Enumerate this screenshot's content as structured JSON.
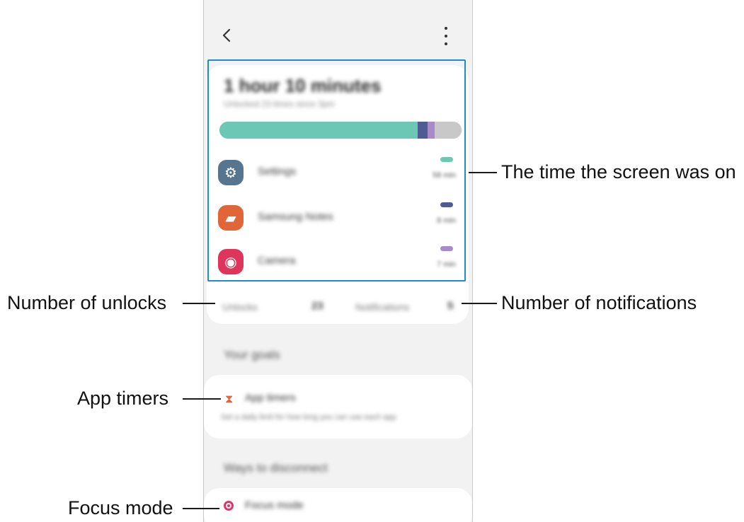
{
  "callouts": {
    "screen_time": "The time the screen was on",
    "unlocks": "Number of unlocks",
    "notifications": "Number of notifications",
    "app_timers": "App timers",
    "focus_mode": "Focus mode"
  },
  "topbar": {
    "back_icon": "chevron-left-icon",
    "more_icon": "more-vertical-icon"
  },
  "summary": {
    "total_time": "1 hour 10 minutes",
    "subtitle": "Unlocked 23 times since 3pm",
    "usage_segments": [
      {
        "app": "Settings",
        "fraction": 0.82,
        "color": "#6cc7b5"
      },
      {
        "app": "Samsung Notes",
        "fraction": 0.04,
        "color": "#4f5c93"
      },
      {
        "app": "Camera",
        "fraction": 0.03,
        "color": "#a98ac9"
      },
      {
        "app": "Other",
        "fraction": 0.11,
        "color": "#c8c8c8"
      }
    ]
  },
  "apps": [
    {
      "name": "Settings",
      "time": "58 min",
      "icon": "gear-icon",
      "icon_color": "#58758f",
      "dash_color": "#6cc7b5"
    },
    {
      "name": "Samsung Notes",
      "time": "8 min",
      "icon": "notes-icon",
      "icon_color": "#e0663a",
      "dash_color": "#4f5c93"
    },
    {
      "name": "Camera",
      "time": "7 min",
      "icon": "camera-icon",
      "icon_color": "#e0355a",
      "dash_color": "#a98ac9"
    }
  ],
  "stats": {
    "unlocks_label": "Unlocks",
    "unlocks_value": "23",
    "notifications_label": "Notifications",
    "notifications_value": "5"
  },
  "goals": {
    "section_title": "Your goals",
    "app_timers_title": "App timers",
    "app_timers_desc": "Set a daily limit for how long you can use each app",
    "app_timers_icon": "hourglass-icon"
  },
  "disconnect": {
    "section_title": "Ways to disconnect",
    "focus_mode_title": "Focus mode",
    "focus_icon": "target-icon"
  },
  "colors": {
    "highlight": "#1f8bc9",
    "leader": "#1a1a1a"
  }
}
